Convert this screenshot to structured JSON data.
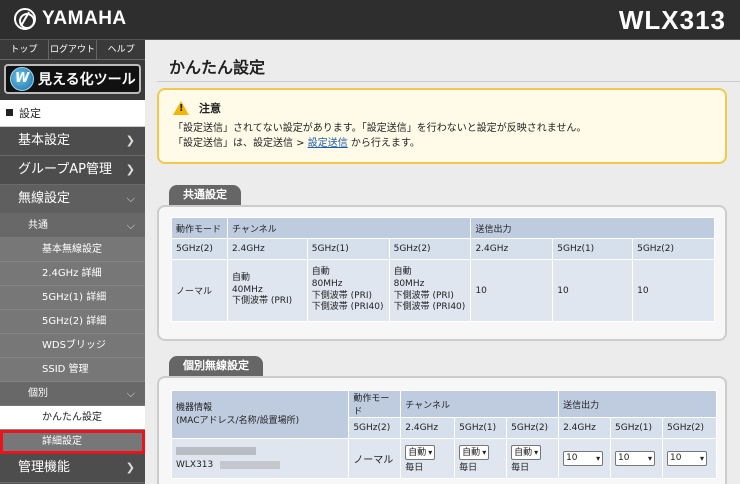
{
  "header": {
    "brand": "YAMAHA",
    "model": "WLX313"
  },
  "sidebar": {
    "toplinks": [
      "トップ",
      "ログアウト",
      "ヘルプ"
    ],
    "vis_tool": "見える化ツール",
    "settings_title": "設定",
    "basic": "基本設定",
    "group_ap": "グループAP管理",
    "wireless": "無線設定",
    "common": "共通",
    "common_items": [
      "基本無線設定",
      "2.4GHz 詳細",
      "5GHz(1) 詳細",
      "5GHz(2) 詳細",
      "WDSブリッジ",
      "SSID 管理"
    ],
    "individual": "個別",
    "individual_items": [
      "かんたん設定",
      "詳細設定"
    ],
    "management": "管理機能"
  },
  "main": {
    "title": "かんたん設定",
    "notice": {
      "heading": "注意",
      "line1": "「設定送信」されてない設定があります。「設定送信」を行わないと設定が反映されません。",
      "line2_pre": "「設定送信」は、設定送信 > ",
      "line2_link": "設定送信",
      "line2_post": " から行えます。"
    },
    "common_section": {
      "tab": "共通設定",
      "headers": {
        "mode": "動作モード",
        "channel": "チャンネル",
        "power": "送信出力"
      },
      "mode_value": "5GHz(2)",
      "bands": [
        "2.4GHz",
        "5GHz(1)",
        "5GHz(2)",
        "2.4GHz",
        "5GHz(1)",
        "5GHz(2)"
      ],
      "row": {
        "label": "ノーマル",
        "ch24": [
          "自動",
          "40MHz",
          "下側波帯 (PRI)"
        ],
        "ch5a": [
          "自動",
          "80MHz",
          "下側波帯 (PRI)",
          "下側波帯 (PRI40)"
        ],
        "ch5b": [
          "自動",
          "80MHz",
          "下側波帯 (PRI)",
          "下側波帯 (PRI40)"
        ],
        "power": [
          "10",
          "10",
          "10"
        ]
      }
    },
    "individual_section": {
      "tab": "個別無線設定",
      "headers": {
        "device": "機器情報\n(MACアドレス/名称/設置場所)",
        "mode": "動作モード",
        "channel": "チャンネル",
        "power": "送信出力"
      },
      "mode_value": "5GHz(2)",
      "bands": [
        "2.4GHz",
        "5GHz(1)",
        "5GHz(2)",
        "2.4GHz",
        "5GHz(1)",
        "5GHz(2)"
      ],
      "row": {
        "device_name": "WLX313",
        "mode": "ノーマル",
        "ch_selects": [
          "自動",
          "自動",
          "自動"
        ],
        "ch_sub": [
          "毎日",
          "毎日",
          "毎日"
        ],
        "power_selects": [
          "10",
          "10",
          "10"
        ]
      }
    }
  }
}
